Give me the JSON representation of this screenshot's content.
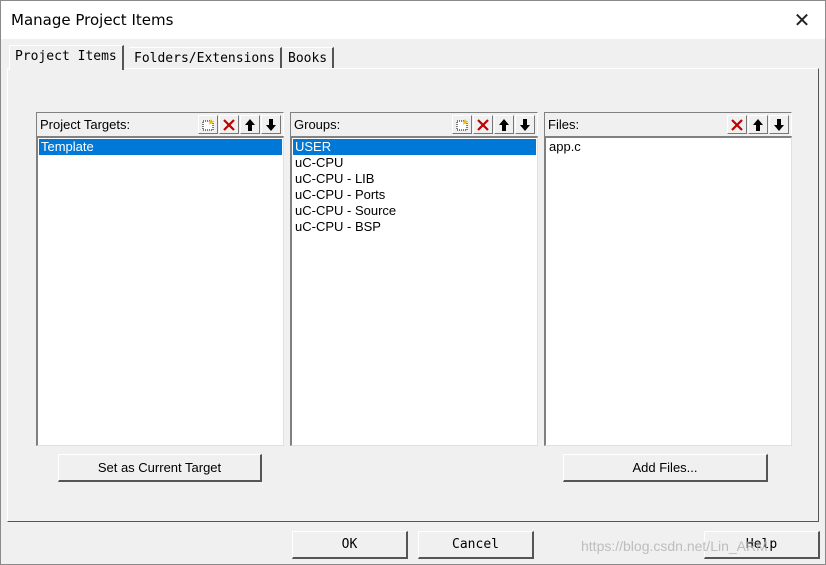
{
  "window": {
    "title": "Manage Project Items",
    "close_glyph": "✕"
  },
  "tabs": [
    {
      "label": "Project Items",
      "active": true
    },
    {
      "label": "Folders/Extensions",
      "active": false
    },
    {
      "label": "Books",
      "active": false
    }
  ],
  "targets": {
    "label": "Project Targets:",
    "items": [
      "Template"
    ],
    "selected_index": 0
  },
  "groups": {
    "label": "Groups:",
    "items": [
      "USER",
      "uC-CPU",
      "uC-CPU - LIB",
      "uC-CPU - Ports",
      "uC-CPU - Source",
      "uC-CPU - BSP"
    ],
    "selected_index": 0
  },
  "files": {
    "label": "Files:",
    "items": [
      "app.c"
    ]
  },
  "buttons": {
    "set_current_target": "Set as Current Target",
    "add_files": "Add Files...",
    "ok": "OK",
    "cancel": "Cancel",
    "help": "Help"
  },
  "watermark": "https://blog.csdn.net/Lin_ARM",
  "colors": {
    "selection": "#0078d7",
    "delete_icon": "#c00000"
  }
}
